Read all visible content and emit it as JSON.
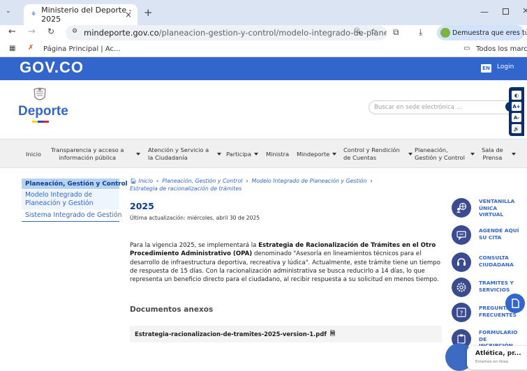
{
  "browser": {
    "tab_title": "Ministerio del Deporte - 2025",
    "url_host": "mindeporte.gov.co",
    "url_path": "/planeacion-gestion-y-control/modelo-integrado-de-planeacion-y...",
    "profile_chip": "Demuestra que eres tú",
    "bookmark_1": "Página Principal | Ac...",
    "bookmarks_folder": "Todos los marcadores"
  },
  "govbar": {
    "logo": "GOV.CO",
    "lang": "EN",
    "login": "Login",
    "color": "#3366cc"
  },
  "header": {
    "brand": "Deporte",
    "search_placeholder": "Buscar en sede electrónica ...",
    "access_buttons": [
      "◐",
      "A+",
      "A-",
      "🔊"
    ]
  },
  "nav": {
    "items": [
      {
        "label": "Inicio"
      },
      {
        "label": "Transparencia y acceso a\ninformación pública"
      },
      {
        "label": "Atención y Servicio a\nla Ciudadanía"
      },
      {
        "label": "Participa"
      },
      {
        "label": "Ministra"
      },
      {
        "label": "Mindeporte"
      },
      {
        "label": "Control y Rendición\nde Cuentas"
      },
      {
        "label": "Planeación,\nGestión y Control"
      },
      {
        "label": "Sala de\nPrensa"
      }
    ]
  },
  "sidebar": {
    "heading": "Planeación, Gestión y Control",
    "item_1": "Modelo Integrado de Planeación y Gestión",
    "item_2": "Sistema Integrado de Gestión"
  },
  "breadcrumb": {
    "home": "Inicio",
    "level_1": "Planeación, Gestión y Control",
    "level_2": "Modelo Integrado de Planeación y Gestión",
    "current": "Estrategia de racionalización de trámites"
  },
  "main": {
    "title": "2025",
    "updated": "Última actualización: miércoles, abril 30 de 2025",
    "para_1": "Para la vigencia 2025, se implementará la ",
    "para_bold_1": "Estrategia de Racionalización de Trámites en el Otro Procedimiento Administrativo (OPA)",
    "para_2": " denominado \"Asesoría en lineamientos técnicos para el desarrollo de infraestructura deportiva, recreativa y lúdica\". Actualmente, este trámite tiene un tiempo de respuesta de 15 días. Con la racionalización administrativa se busca reducirlo a 14 días, lo que representa un beneficio directo para el ciudadano, al recibir respuesta a su solicitud en menos tiempo.",
    "docs_title": "Documentos anexos",
    "doc_name": "Estrategia-racionalizacion-de-tramites-2025-version-1.pdf"
  },
  "services": [
    {
      "label": "VENTANILLA\nÚNICA\nVIRTUAL",
      "icon": "globe-person-icon"
    },
    {
      "label": "AGENDE AQUÍ\nSU CITA",
      "icon": "chat-icon"
    },
    {
      "label": "CONSULTA\nCIUDADANA",
      "icon": "headset-icon"
    },
    {
      "label": "TRAMITES Y\nSERVICIOS",
      "icon": "gear-icon"
    },
    {
      "label": "PREGUNTAS\nFRECUENTES",
      "icon": "question-icon"
    },
    {
      "label": "FORMULARIO\nDE\nINCRIPCIÓN",
      "icon": "form-icon"
    }
  ],
  "chat": {
    "title": "Atlética, pr...",
    "subtitle": "Estamos en línea"
  }
}
